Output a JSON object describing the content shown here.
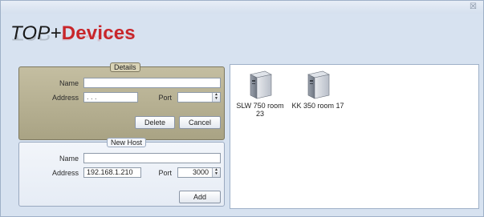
{
  "window": {
    "close_glyph": "☒"
  },
  "logo": {
    "part1": "TOP+",
    "part2": "Devices",
    "accent_color": "#c8262b"
  },
  "details": {
    "legend": "Details",
    "name_label": "Name",
    "name_value": "",
    "address_label": "Address",
    "address_value": ". . .",
    "port_label": "Port",
    "port_value": "",
    "delete_label": "Delete",
    "cancel_label": "Cancel"
  },
  "new_host": {
    "legend": "New Host",
    "name_label": "Name",
    "name_value": "",
    "address_label": "Address",
    "address_value": "192.168.1.210",
    "port_label": "Port",
    "port_value": "3000",
    "add_label": "Add"
  },
  "devices": [
    {
      "label": "SLW 750 room 23",
      "icon": "server-icon"
    },
    {
      "label": "KK 350 room 17",
      "icon": "server-icon"
    }
  ]
}
